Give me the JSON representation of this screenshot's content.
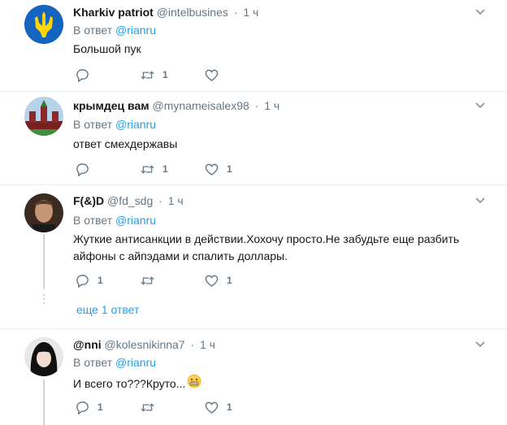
{
  "reply_prefix": "В ответ",
  "tweets": [
    {
      "name": "Kharkiv patriot",
      "handle": "@intelbusines",
      "time": "1 ч",
      "reply_to": "@rianru",
      "text": "Большой пук",
      "replies": "",
      "retweets": "1",
      "likes": ""
    },
    {
      "name": "крымдец вам",
      "handle": "@mynameisalex98",
      "time": "1 ч",
      "reply_to": "@rianru",
      "text": "ответ смехдержавы",
      "replies": "",
      "retweets": "1",
      "likes": "1"
    },
    {
      "name": "F(&)D",
      "handle": "@fd_sdg",
      "time": "1 ч",
      "reply_to": "@rianru",
      "text": "Жуткие антисанкции в действии.Хохочу просто.Не забудьте еще разбить айфоны с айпэдами и спалить доллары.",
      "replies": "1",
      "retweets": "",
      "likes": "1"
    },
    {
      "name": "@nni",
      "handle": "@kolesnikinna7",
      "time": "1 ч",
      "reply_to": "@rianru",
      "text": "И всего то???Круто...",
      "emoji": "grimacing-face",
      "replies": "1",
      "retweets": "",
      "likes": "1"
    }
  ],
  "more_replies": "еще 1 ответ",
  "colors": {
    "link": "#1da1f2",
    "muted": "#657786",
    "text": "#14171a",
    "separator": "#e6ecf0"
  }
}
